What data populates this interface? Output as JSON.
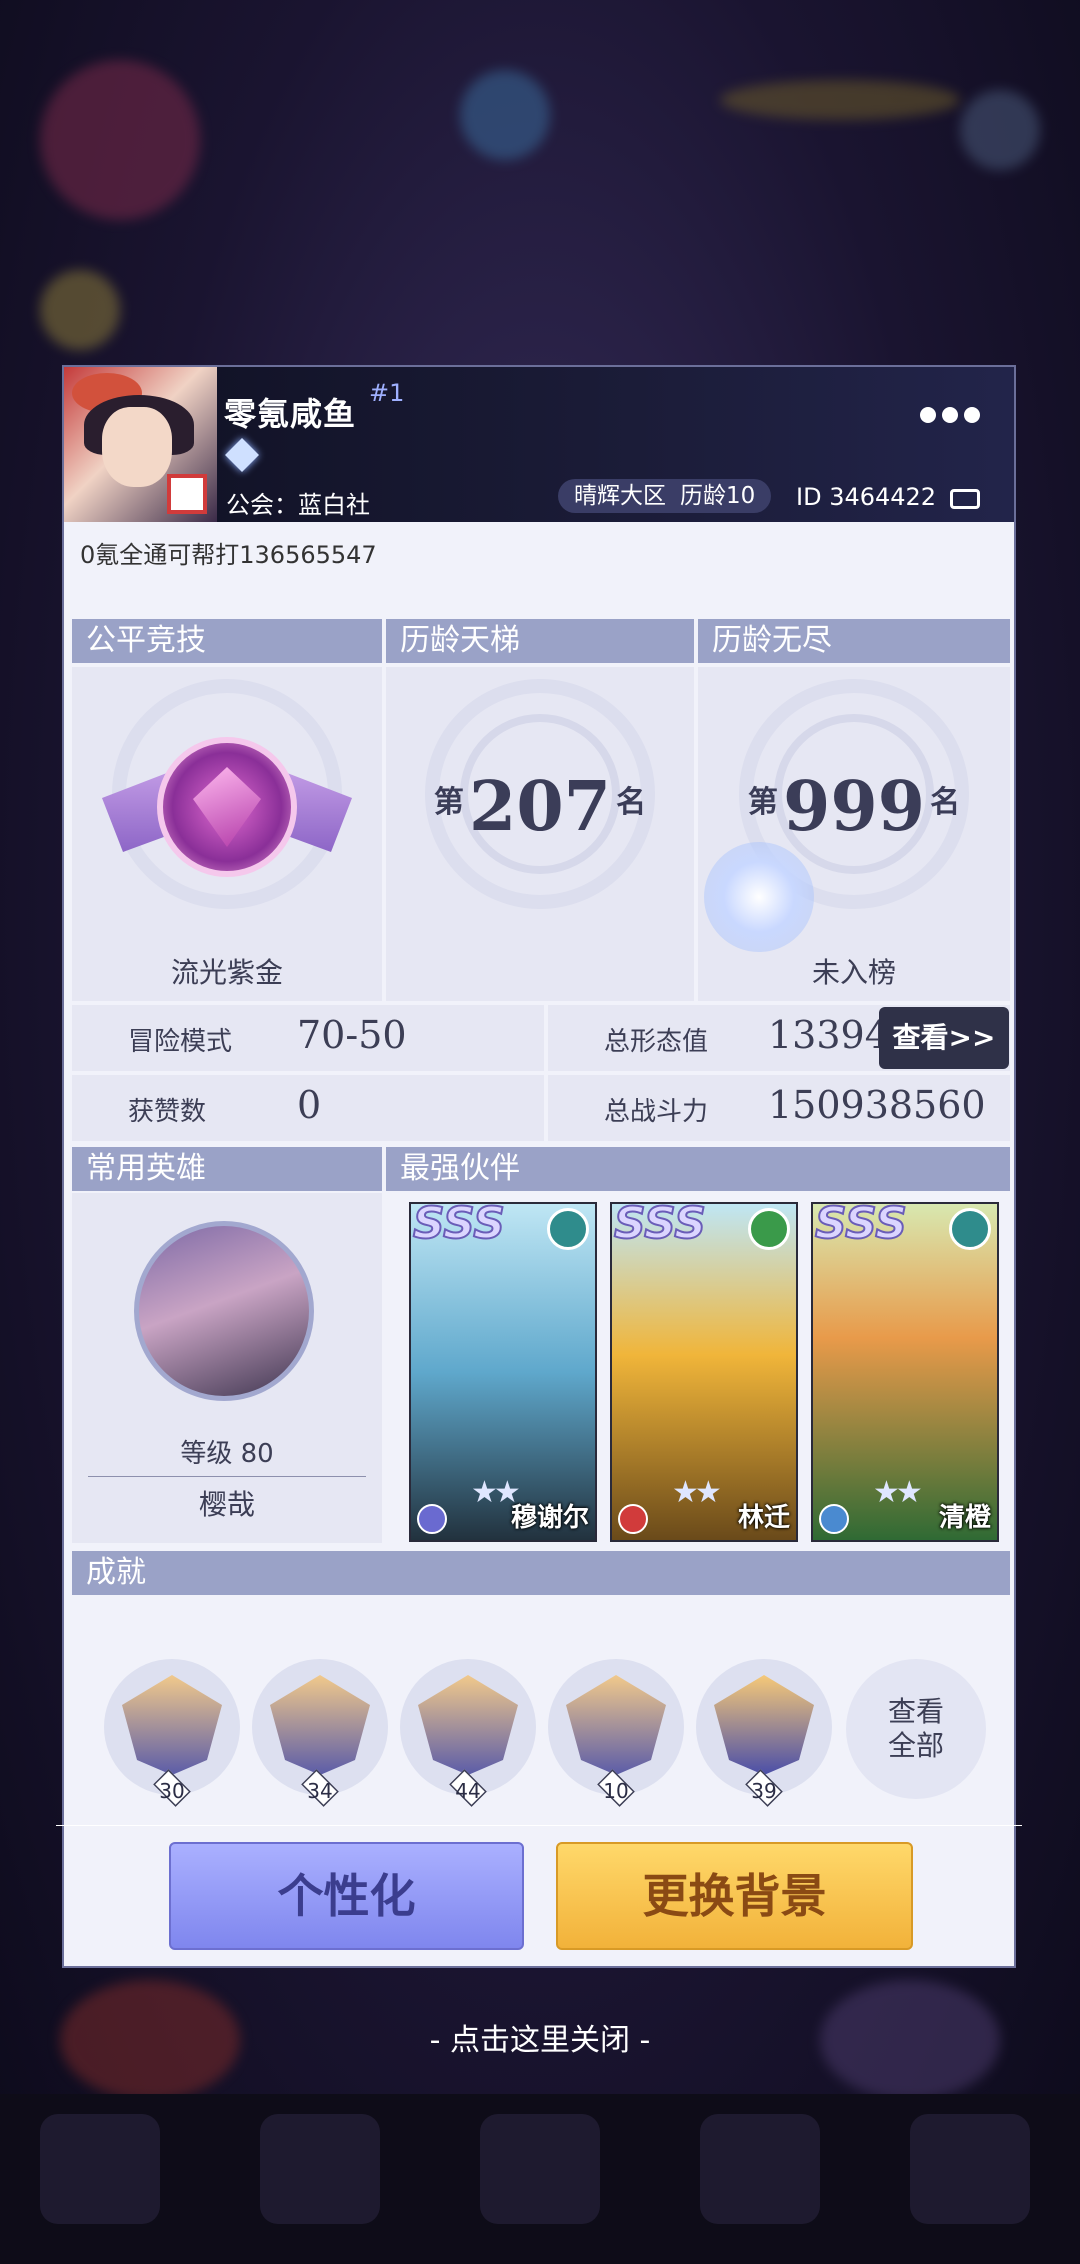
{
  "header": {
    "player_name": "零氪咸鱼",
    "rank_tag": "#1",
    "guild": "公会：蓝白社",
    "server": "晴辉大区",
    "seniority": "历龄10",
    "player_id": "ID 3464422"
  },
  "signature": "0氪全通可帮打136565547",
  "sections": {
    "fair_arena": "公平竞技",
    "seniority_ladder": "历龄天梯",
    "seniority_endless": "历龄无尽",
    "common_hero": "常用英雄",
    "strongest_partners": "最强伙伴",
    "achievements": "成就"
  },
  "ranks": {
    "fair_arena_tier": "流光紫金",
    "ladder_prefix": "第",
    "ladder_number": "207",
    "ladder_suffix": "名",
    "endless_prefix": "第",
    "endless_number": "999",
    "endless_suffix": "名",
    "endless_status": "未入榜"
  },
  "stats": {
    "adventure_label": "冒险模式",
    "adventure_value": "70-50",
    "likes_label": "获赞数",
    "likes_value": "0",
    "form_label": "总形态值",
    "form_value": "13394",
    "power_label": "总战斗力",
    "power_value": "150938560",
    "view_button": "查看>>"
  },
  "hero": {
    "level": "等级 80",
    "name": "樱哉"
  },
  "partners": [
    {
      "grade": "SSS",
      "name": "穆谢尔",
      "stars": "★★",
      "accent": "#4aa6c8"
    },
    {
      "grade": "SSS",
      "name": "林迁",
      "stars": "★★",
      "accent": "#e0a12a"
    },
    {
      "grade": "SSS",
      "name": "清橙",
      "stars": "★★",
      "accent": "#5a9a52"
    }
  ],
  "achievements": {
    "badges": [
      "30",
      "34",
      "44",
      "10",
      "39"
    ],
    "view_all": "查看\n全部"
  },
  "buttons": {
    "personalize": "个性化",
    "change_background": "更换背景"
  },
  "close_hint": "- 点击这里关闭 -"
}
